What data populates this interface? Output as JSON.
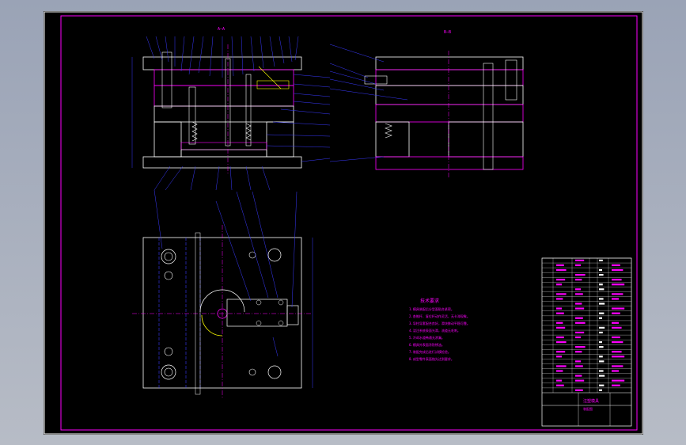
{
  "drawing": {
    "section_a_title": "A—A",
    "section_b_title": "B—B",
    "notes_title": "技术要求",
    "notes_lines": [
      "1.模具装配后分型面贴合紧密。",
      "2.各推杆、复位杆动作灵活，无卡滞现象。",
      "3.导柱导套配合良好，滑块移动平稳可靠。",
      "4.浇注系统表面光滑，流道无毛刺。",
      "5.冷却水道畅通无渗漏。",
      "6.模具外表面涂防锈油。",
      "7.装配完成后进行试模检验。",
      "8.成型零件表面抛光达到要求。"
    ],
    "title_block_name": "注塑模具",
    "title_block_sub": "装配图"
  }
}
